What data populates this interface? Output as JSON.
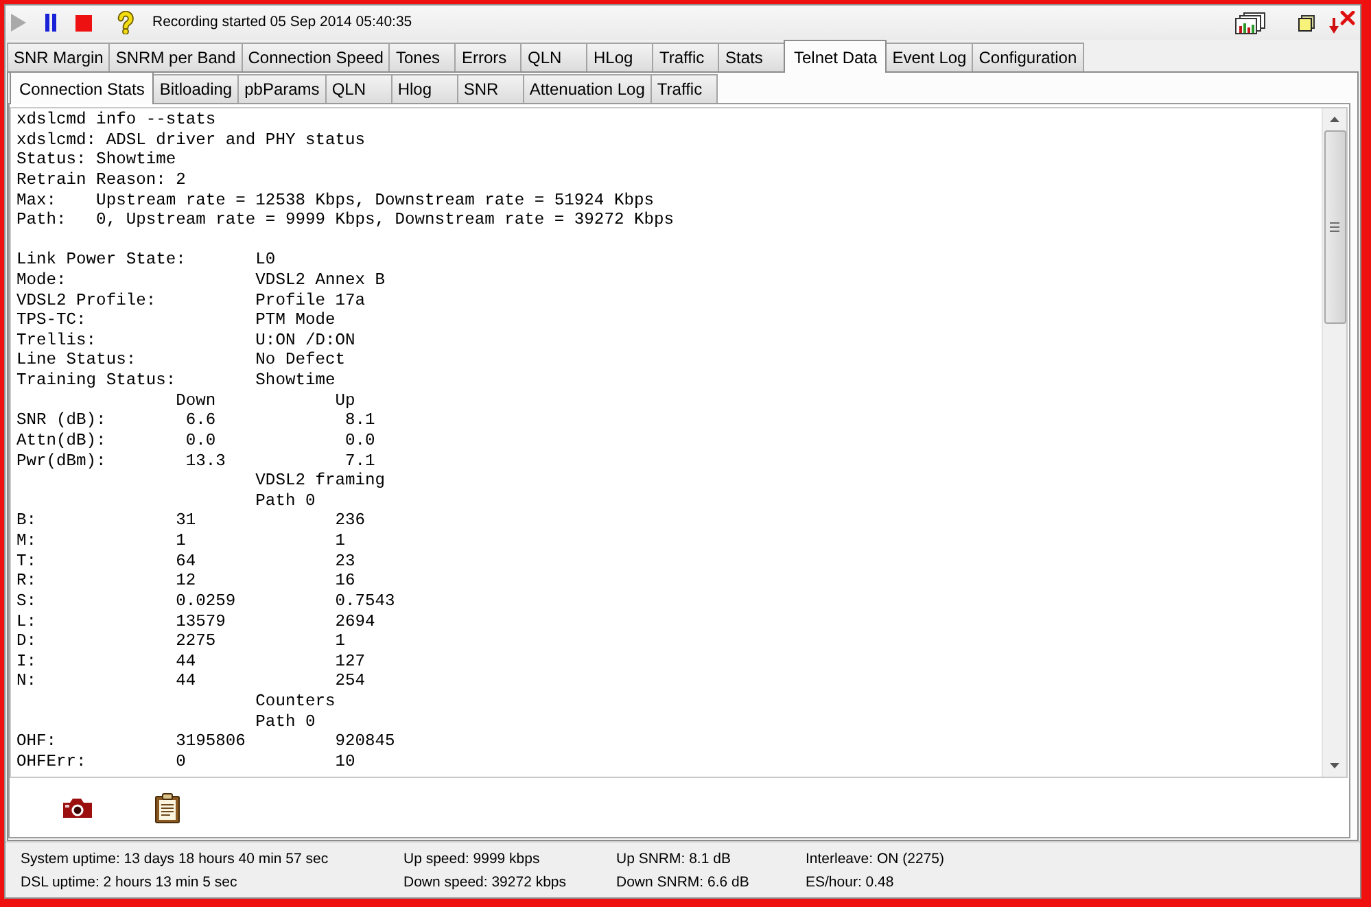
{
  "controls": [
    {
      "kind": "play",
      "disabled": true
    },
    {
      "kind": "pause",
      "disabled": false
    },
    {
      "kind": "stop",
      "disabled": false
    }
  ],
  "status_message": "Recording started 05 Sep 2014 05:40:35",
  "main_tabs": [
    {
      "label": "SNR Margin",
      "selected": false
    },
    {
      "label": "SNRM per Band",
      "selected": false
    },
    {
      "label": "Connection Speed",
      "selected": false
    },
    {
      "label": "Tones",
      "selected": false
    },
    {
      "label": "Errors",
      "selected": false
    },
    {
      "label": "QLN",
      "selected": false
    },
    {
      "label": "HLog",
      "selected": false
    },
    {
      "label": "Traffic",
      "selected": false
    },
    {
      "label": "Stats",
      "selected": false
    },
    {
      "label": "Telnet Data",
      "selected": true
    },
    {
      "label": "Event Log",
      "selected": false
    },
    {
      "label": "Configuration",
      "selected": false
    }
  ],
  "sub_tabs": [
    {
      "label": "Connection Stats",
      "selected": true
    },
    {
      "label": "Bitloading",
      "selected": false
    },
    {
      "label": "pbParams",
      "selected": false
    },
    {
      "label": "QLN",
      "selected": false
    },
    {
      "label": "Hlog",
      "selected": false
    },
    {
      "label": "SNR",
      "selected": false
    },
    {
      "label": "Attenuation Log",
      "selected": false
    },
    {
      "label": "Traffic",
      "selected": false
    }
  ],
  "output": {
    "blocks": [
      [
        "xdslcmd info --stats",
        "xdslcmd: ADSL driver and PHY status",
        "Status: Showtime",
        "Retrain Reason: 2",
        "Max:    Upstream rate = 12538 Kbps, Downstream rate = 51924 Kbps",
        "Path:   0, Upstream rate = 9999 Kbps, Downstream rate = 39272 Kbps"
      ],
      [
        "Link Power State:       L0",
        "Mode:                   VDSL2 Annex B",
        "VDSL2 Profile:          Profile 17a",
        "TPS-TC:                 PTM Mode",
        "Trellis:                U:ON /D:ON",
        "Line Status:            No Defect",
        "Training Status:        Showtime",
        "                Down            Up",
        "SNR (dB):        6.6             8.1",
        "Attn(dB):        0.0             0.0",
        "Pwr(dBm):        13.3            7.1",
        "                        VDSL2 framing",
        "                        Path 0",
        "B:              31              236",
        "M:              1               1",
        "T:              64              23",
        "R:              12              16",
        "S:              0.0259          0.7543",
        "L:              13579           2694",
        "D:              2275            1",
        "I:              44              127",
        "N:              44              254",
        "                        Counters",
        "                        Path 0",
        "OHF:            3195806         920845",
        "OHFErr:         0               10"
      ]
    ]
  },
  "status_bar": {
    "columns": [
      [
        "System uptime: 13 days 18 hours 40 min 57 sec",
        "DSL uptime: 2 hours 13 min 5 sec"
      ],
      [
        "Up speed: 9999 kbps",
        "Down speed: 39272 kbps"
      ],
      [
        "Up SNRM: 8.1 dB",
        "Down SNRM: 6.6 dB"
      ],
      [
        "Interleave: ON (2275)",
        "ES/hour: 0.48"
      ]
    ]
  }
}
